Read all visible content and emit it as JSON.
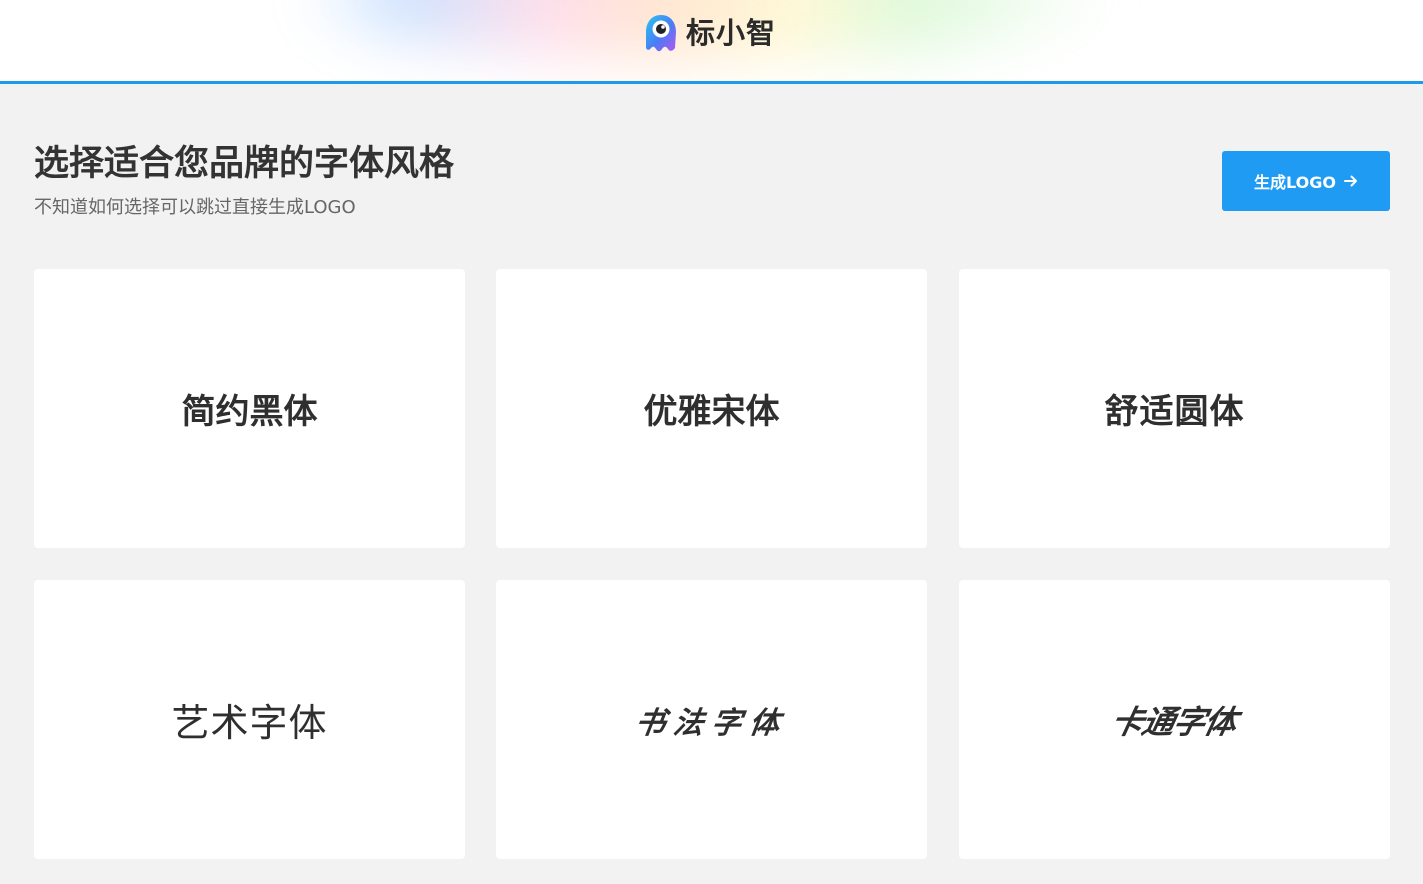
{
  "header": {
    "brand_name": "标小智",
    "logo_icon": "monster-mascot-icon",
    "accent_color": "#1e9be8"
  },
  "main": {
    "title": "选择适合您品牌的字体风格",
    "subtitle": "不知道如何选择可以跳过直接生成LOGO",
    "generate_button": {
      "label": "生成LOGO",
      "icon": "arrow-right-icon",
      "color": "#1f9bf4"
    },
    "font_styles": [
      {
        "label": "简约黑体"
      },
      {
        "label": "优雅宋体"
      },
      {
        "label": "舒适圆体"
      },
      {
        "label": "艺术字体"
      },
      {
        "label": "书法字体"
      },
      {
        "label": "卡通字体"
      }
    ]
  }
}
